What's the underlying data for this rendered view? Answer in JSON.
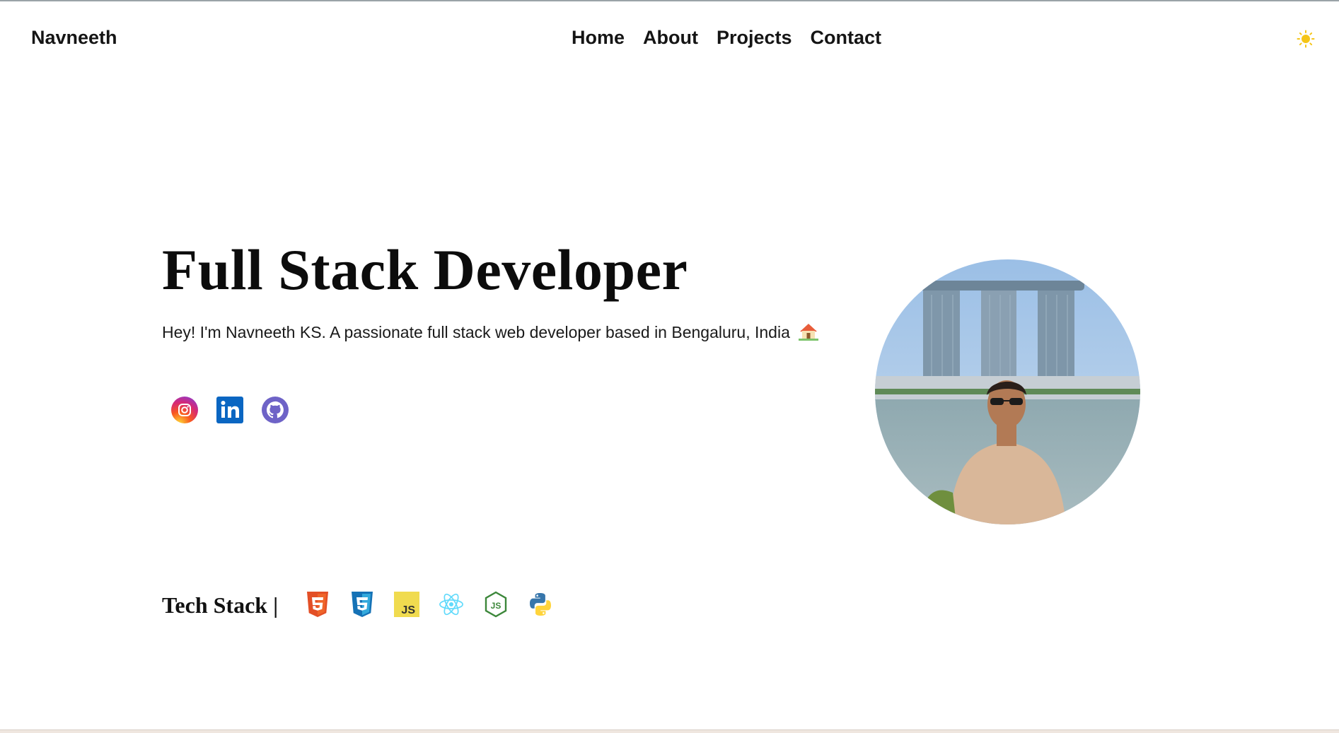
{
  "header": {
    "brand": "Navneeth",
    "nav": [
      "Home",
      "About",
      "Projects",
      "Contact"
    ],
    "theme_icon": "sun-icon"
  },
  "hero": {
    "title": "Full Stack Developer",
    "subtitle": "Hey! I'm Navneeth KS. A passionate full stack web developer based in Bengaluru, India",
    "subtitle_emoji": "house-icon",
    "socials": [
      "instagram-icon",
      "linkedin-icon",
      "github-icon"
    ],
    "avatar": "profile-photo"
  },
  "tech": {
    "label": "Tech Stack |",
    "icons": [
      "html5-icon",
      "css3-icon",
      "javascript-icon",
      "react-icon",
      "nodejs-icon",
      "python-icon"
    ]
  },
  "colors": {
    "text": "#151515",
    "sun": "#f5c518",
    "instagram": "#d62976",
    "linkedin": "#0a66c2",
    "github": "#6e63c7",
    "html": "#e34f26",
    "css": "#1572b6",
    "js": "#f0db4f",
    "react": "#61dafb",
    "node": "#3c873a",
    "python": "#3776ab"
  }
}
